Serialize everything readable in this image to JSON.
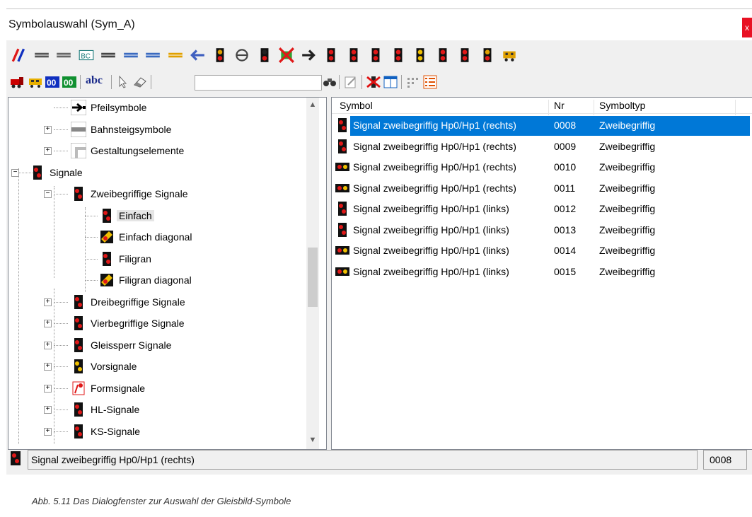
{
  "window": {
    "title": "Symbolauswahl (Sym_A)",
    "close_label": "x"
  },
  "toolbar1": {
    "icons": [
      "track-double-icon",
      "track-straight-icon",
      "track-platform-icon",
      "track-label-icon",
      "track-cross-icon",
      "track-end-left-icon",
      "track-end-right-icon",
      "track-arrow-up-icon",
      "arrow-left-icon",
      "signal-small-icon",
      "circle-line-icon",
      "signal-tower-icon",
      "crossed-out-icon",
      "arrow-right-icon",
      "signal-red-icon",
      "signal-black-icon",
      "signal-pink-icon",
      "signal-shunt-icon",
      "signal-yellow-icon",
      "signal-red2-icon",
      "signal-double-icon",
      "signal-v-icon",
      "car-icon"
    ]
  },
  "toolbar2": {
    "icons": [
      "locomotive-icon",
      "car-yellow-icon",
      "blue-00-icon",
      "green-00-icon"
    ],
    "abc_label": "abc",
    "right_icons": [
      "binoculars-icon",
      "edit-icon",
      "delete-icon",
      "grid-view-icon",
      "small-icons-icon",
      "list-view-icon"
    ]
  },
  "search": {
    "value": ""
  },
  "tree": {
    "nodes": [
      {
        "label": "Pfeilsymbole",
        "level": 2,
        "icon": "arrow-symbol-icon",
        "expander": ""
      },
      {
        "label": "Bahnsteigsymbole",
        "level": 2,
        "icon": "platform-symbol-icon",
        "expander": "+"
      },
      {
        "label": "Gestaltungselemente",
        "level": 2,
        "icon": "design-element-icon",
        "expander": "+"
      },
      {
        "label": "Signale",
        "level": 1,
        "icon": "signal-icon",
        "expander": "-"
      },
      {
        "label": "Zweibegriffige Signale",
        "level": 2,
        "icon": "signal-icon",
        "expander": "-"
      },
      {
        "label": "Einfach",
        "level": 3,
        "icon": "signal-icon",
        "expander": "",
        "selected": true
      },
      {
        "label": "Einfach diagonal",
        "level": 3,
        "icon": "signal-diagonal-icon",
        "expander": ""
      },
      {
        "label": "Filigran",
        "level": 3,
        "icon": "signal-icon",
        "expander": ""
      },
      {
        "label": "Filigran diagonal",
        "level": 3,
        "icon": "signal-diagonal-icon",
        "expander": ""
      },
      {
        "label": "Dreibegriffige Signale",
        "level": 2,
        "icon": "signal-icon",
        "expander": "+"
      },
      {
        "label": "Vierbegriffige Signale",
        "level": 2,
        "icon": "signal-icon",
        "expander": "+"
      },
      {
        "label": "Gleissperr Signale",
        "level": 2,
        "icon": "signal-icon",
        "expander": "+"
      },
      {
        "label": "Vorsignale",
        "level": 2,
        "icon": "signal-yellow-icon",
        "expander": "+"
      },
      {
        "label": "Formsignale",
        "level": 2,
        "icon": "form-signal-icon",
        "expander": "+"
      },
      {
        "label": "HL-Signale",
        "level": 2,
        "icon": "signal-icon",
        "expander": "+"
      },
      {
        "label": "KS-Signale",
        "level": 2,
        "icon": "signal-icon",
        "expander": "+"
      }
    ]
  },
  "list": {
    "columns": [
      "Symbol",
      "Nr",
      "Symboltyp"
    ],
    "rows": [
      {
        "symbol": "Signal zweibegriffig Hp0/Hp1 (rechts)",
        "nr": "0008",
        "type": "Zweibegriffig",
        "icon": "signal-icon",
        "selected": true
      },
      {
        "symbol": "Signal zweibegriffig Hp0/Hp1 (rechts)",
        "nr": "0009",
        "type": "Zweibegriffig",
        "icon": "signal-icon"
      },
      {
        "symbol": "Signal zweibegriffig Hp0/Hp1 (rechts)",
        "nr": "0010",
        "type": "Zweibegriffig",
        "icon": "signal-horizontal-icon"
      },
      {
        "symbol": "Signal zweibegriffig Hp0/Hp1 (rechts)",
        "nr": "0011",
        "type": "Zweibegriffig",
        "icon": "signal-horizontal-icon"
      },
      {
        "symbol": "Signal zweibegriffig Hp0/Hp1 (links)",
        "nr": "0012",
        "type": "Zweibegriffig",
        "icon": "signal-icon"
      },
      {
        "symbol": "Signal zweibegriffig Hp0/Hp1 (links)",
        "nr": "0013",
        "type": "Zweibegriffig",
        "icon": "signal-icon"
      },
      {
        "symbol": "Signal zweibegriffig Hp0/Hp1 (links)",
        "nr": "0014",
        "type": "Zweibegriffig",
        "icon": "signal-horizontal-icon"
      },
      {
        "symbol": "Signal zweibegriffig Hp0/Hp1 (links)",
        "nr": "0015",
        "type": "Zweibegriffig",
        "icon": "signal-horizontal-icon"
      }
    ]
  },
  "statusbar": {
    "text": "Signal zweibegriffig Hp0/Hp1 (rechts)",
    "nr": "0008",
    "icon": "signal-icon"
  },
  "caption": {
    "text": "Abb. 5.11    Das Dialogfenster zur Auswahl der Gleisbild-Symbole"
  },
  "colors": {
    "selection": "#0078d7",
    "signal_red": "#e01818",
    "signal_yellow": "#f0c000",
    "signal_black": "#111111"
  }
}
